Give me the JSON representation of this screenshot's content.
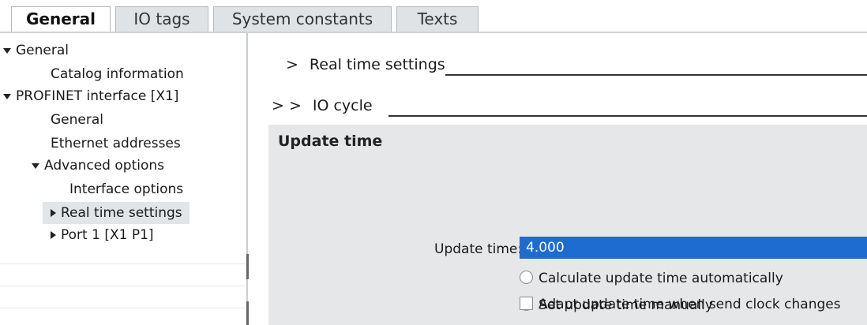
{
  "tabs": [
    {
      "label": "General",
      "active": true
    },
    {
      "label": "IO tags",
      "active": false
    },
    {
      "label": "System constants",
      "active": false
    },
    {
      "label": "Texts",
      "active": false
    }
  ],
  "tree": {
    "items": [
      {
        "label": "General",
        "expander": "expanded"
      },
      {
        "label": "Catalog information",
        "expander": "none"
      },
      {
        "label": "PROFINET interface [X1]",
        "expander": "expanded"
      },
      {
        "label": "General",
        "expander": "none"
      },
      {
        "label": "Ethernet addresses",
        "expander": "none"
      },
      {
        "label": "Advanced options",
        "expander": "expanded"
      },
      {
        "label": "Interface options",
        "expander": "none"
      },
      {
        "label": "Real time settings",
        "expander": "collapsed",
        "selected": true
      },
      {
        "label": "Port 1 [X1 P1]",
        "expander": "collapsed"
      }
    ]
  },
  "content": {
    "breadcrumb_1": {
      "chevron": ">",
      "label": "Real time settings"
    },
    "breadcrumb_2": {
      "chevron": "> >",
      "label": "IO cycle"
    },
    "section": {
      "title": "Update time",
      "radio_auto": {
        "label": "Calculate update time automatically",
        "checked": false
      },
      "radio_manual": {
        "label": "Set update time manually",
        "checked": true
      },
      "update_time": {
        "label": "Update time:",
        "value": "4.000"
      },
      "adapt_checkbox": {
        "label": "Adapt update time when send clock changes",
        "checked": false
      }
    }
  },
  "colors": {
    "accent": "#1f6cd0",
    "panel_bg": "#e5e7e9",
    "selection_bg": "#e1e5e8",
    "tab_inactive_bg": "#dfe3e5"
  }
}
